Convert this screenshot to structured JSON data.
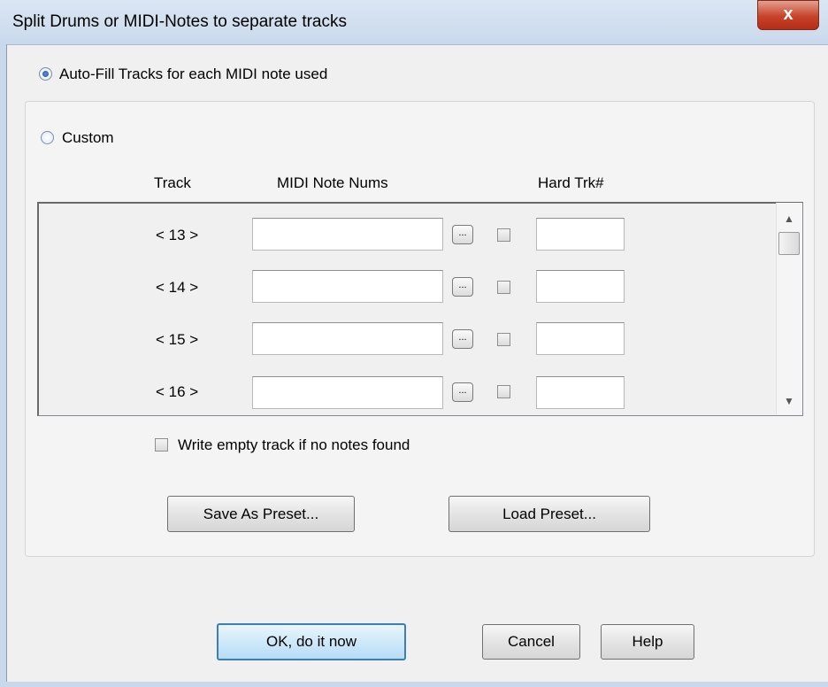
{
  "window": {
    "title": "Split Drums or MIDI-Notes to separate tracks",
    "close_label": "x"
  },
  "mode": {
    "autofill_label": "Auto-Fill Tracks for each MIDI note used",
    "custom_label": "Custom",
    "selected": "autofill"
  },
  "table": {
    "headers": {
      "track": "Track",
      "midi": "MIDI Note Nums",
      "hard": "Hard Trk#"
    },
    "rows": [
      {
        "track": "< 13 >",
        "midi_value": "",
        "dots_label": "...",
        "hard_checked": false,
        "hard_value": ""
      },
      {
        "track": "< 14 >",
        "midi_value": "",
        "dots_label": "...",
        "hard_checked": false,
        "hard_value": ""
      },
      {
        "track": "< 15 >",
        "midi_value": "",
        "dots_label": "...",
        "hard_checked": false,
        "hard_value": ""
      },
      {
        "track": "< 16 >",
        "midi_value": "",
        "dots_label": "...",
        "hard_checked": false,
        "hard_value": ""
      }
    ],
    "scroll_up_icon": "triangle-up",
    "scroll_down_icon": "triangle-down"
  },
  "options": {
    "write_empty_label": "Write empty track if no notes found",
    "write_empty_checked": false
  },
  "preset_buttons": {
    "save": "Save As Preset...",
    "load": "Load Preset..."
  },
  "footer": {
    "ok": "OK, do it now",
    "cancel": "Cancel",
    "help": "Help"
  }
}
